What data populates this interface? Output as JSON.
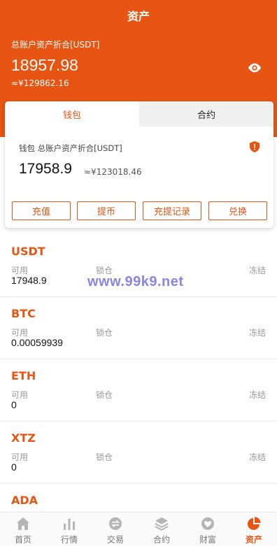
{
  "header": {
    "title": "资产",
    "total_label": "总账户资产折合[USDT]",
    "total_value": "18957.98",
    "total_cny": "≈¥129862.16"
  },
  "card": {
    "tabs": [
      {
        "label": "钱包",
        "active": true
      },
      {
        "label": "合约",
        "active": false
      }
    ],
    "wallet_label": "钱包 总账户资产折合[USDT]",
    "wallet_value": "17958.9",
    "wallet_cny": "≈¥123018.46",
    "buttons": [
      "充值",
      "提币",
      "充提记录",
      "兑换"
    ]
  },
  "asset_labels": {
    "available": "可用",
    "locked": "锁仓",
    "frozen": "冻结"
  },
  "assets": [
    {
      "name": "USDT",
      "available": "17948.9"
    },
    {
      "name": "BTC",
      "available": "0.00059939"
    },
    {
      "name": "ETH",
      "available": "0"
    },
    {
      "name": "XTZ",
      "available": "0"
    },
    {
      "name": "ADA",
      "available": ""
    }
  ],
  "watermark": "www.99k9.net",
  "tabbar": [
    {
      "label": "首页",
      "icon": "home-icon"
    },
    {
      "label": "行情",
      "icon": "bar-chart-icon"
    },
    {
      "label": "交易",
      "icon": "exchange-icon"
    },
    {
      "label": "合约",
      "icon": "layers-icon"
    },
    {
      "label": "财富",
      "icon": "heart-icon"
    },
    {
      "label": "资产",
      "icon": "pie-chart-icon",
      "active": true
    }
  ],
  "colors": {
    "accent": "#e85412",
    "inactive_icon": "#b5b5b5"
  }
}
